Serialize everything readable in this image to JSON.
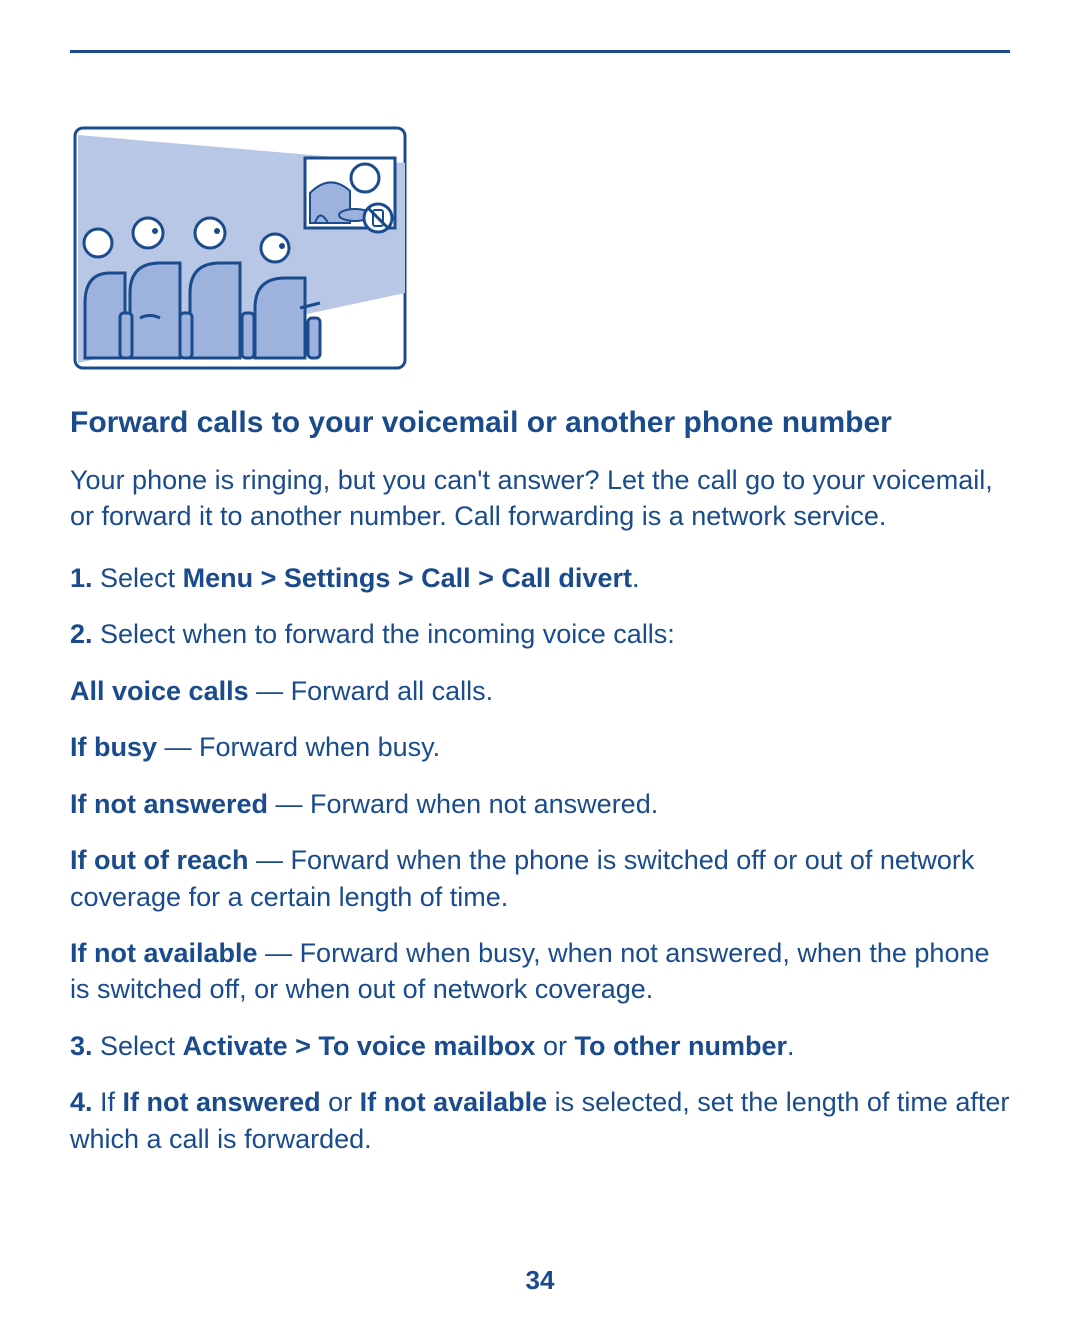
{
  "title": "Forward calls to your voicemail or another phone number",
  "intro": "Your phone is ringing, but you can't answer? Let the call go to your voicemail, or forward it to another number. Call forwarding is a network service.",
  "steps": {
    "s1_num": "1.",
    "s1_a": " Select ",
    "s1_b": "Menu > Settings > Call > Call divert",
    "s1_c": ".",
    "s2_num": "2.",
    "s2_a": " Select when to forward the incoming voice calls:",
    "s3_num": "3.",
    "s3_a": " Select ",
    "s3_b": "Activate > To voice mailbox",
    "s3_c": " or ",
    "s3_d": "To other number",
    "s3_e": ".",
    "s4_num": "4.",
    "s4_a": " If ",
    "s4_b": "If not answered",
    "s4_c": " or ",
    "s4_d": "If not available",
    "s4_e": " is selected, set the length of time after which a call is forwarded."
  },
  "options": {
    "o1_label": "All voice calls",
    "o1_desc": " — Forward all calls.",
    "o2_label": "If busy",
    "o2_desc": " — Forward when busy.",
    "o3_label": "If not answered",
    "o3_desc": " — Forward when not answered.",
    "o4_label": "If out of reach",
    "o4_desc": " — Forward when the phone is switched off or out of network coverage for a certain length of time.",
    "o5_label": "If not available",
    "o5_desc": " — Forward when busy, when not answered, when the phone is switched off, or when out of network coverage."
  },
  "page_number": "34"
}
